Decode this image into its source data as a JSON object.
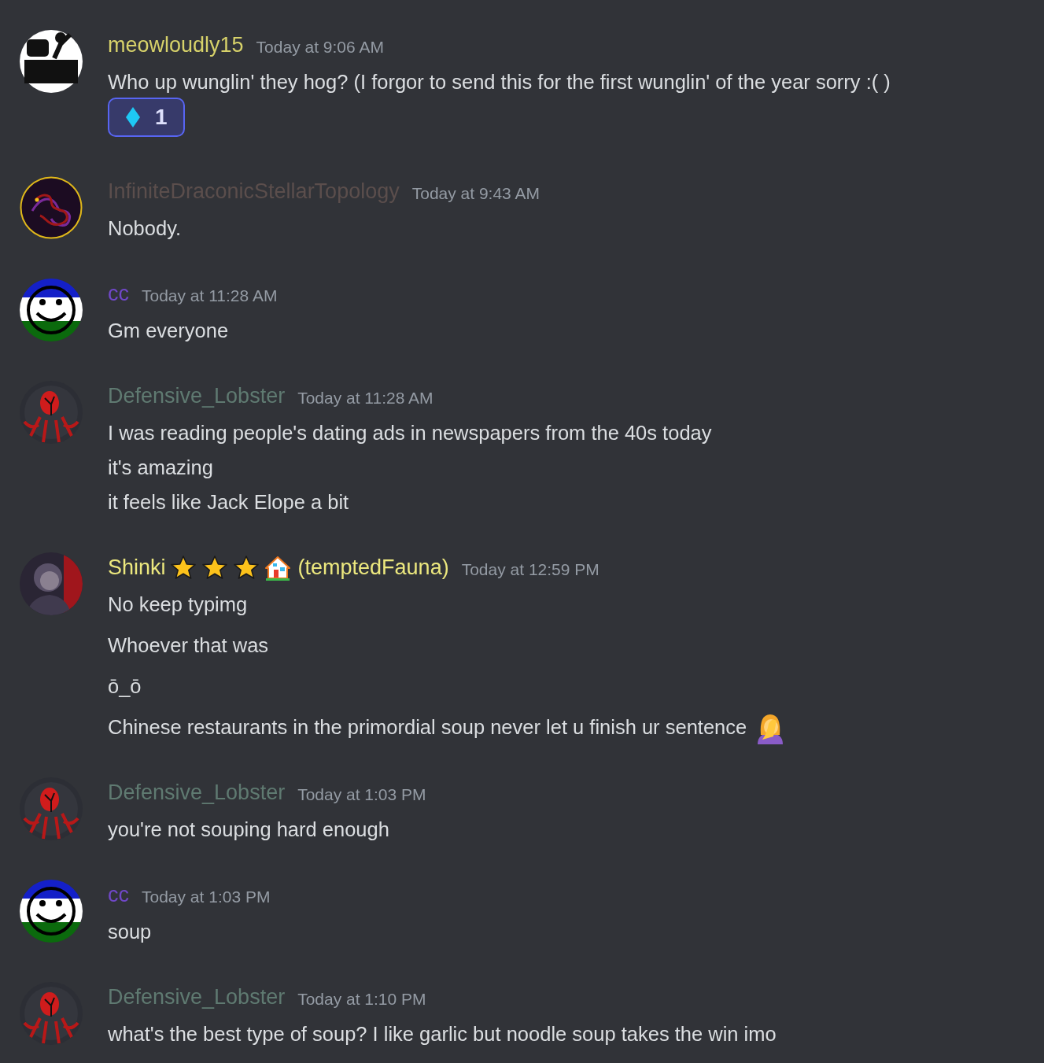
{
  "groups": [
    {
      "avatar": {
        "kind": "sign"
      },
      "author": "meowloudly15",
      "color": "#d7d26a",
      "timestamp": "Today at 9:06 AM",
      "messages": [
        {
          "lines": [
            "Who up wunglin' they hog? (I forgor to send this for the first wunglin' of the year sorry :( )"
          ],
          "reactions": [
            {
              "kind": "diamond",
              "count": "1",
              "selected": true
            }
          ]
        }
      ]
    },
    {
      "avatar": {
        "kind": "dragon"
      },
      "author": "InfiniteDraconicStellarTopology",
      "color": "#5b4e4c",
      "timestamp": "Today at 9:43 AM",
      "messages": [
        {
          "lines": [
            "Nobody."
          ]
        }
      ]
    },
    {
      "avatar": {
        "kind": "smiley"
      },
      "author": "cc",
      "color": "#7048c8",
      "timestamp": "Today at 11:28 AM",
      "messages": [
        {
          "lines": [
            "Gm everyone"
          ]
        }
      ]
    },
    {
      "avatar": {
        "kind": "lobster"
      },
      "author": "Defensive_Lobster",
      "color": "#5f7a71",
      "timestamp": "Today at 11:28 AM",
      "messages": [
        {
          "lines": [
            "I was reading people's dating ads in newspapers from the 40s today",
            "it's amazing",
            "it feels like Jack Elope a bit"
          ]
        }
      ]
    },
    {
      "avatar": {
        "kind": "portrait"
      },
      "author": "Shinki",
      "author_badges": [
        {
          "kind": "star"
        },
        {
          "kind": "star"
        },
        {
          "kind": "star"
        },
        {
          "kind": "house"
        }
      ],
      "author_suffix": "(temptedFauna)",
      "color": "#ece87e",
      "timestamp": "Today at 12:59 PM",
      "messages": [
        {
          "lines": [
            "No keep typimg"
          ]
        },
        {
          "lines": [
            "Whoever that was"
          ]
        },
        {
          "lines": [
            "ō_ō"
          ]
        },
        {
          "lines": [
            "Chinese restaurants in the primordial soup never let u finish ur sentence"
          ],
          "trailing_emoji": {
            "kind": "facepalm"
          }
        }
      ]
    },
    {
      "avatar": {
        "kind": "lobster"
      },
      "author": "Defensive_Lobster",
      "color": "#5f7a71",
      "timestamp": "Today at 1:03 PM",
      "messages": [
        {
          "lines": [
            "you're not souping hard enough"
          ]
        }
      ]
    },
    {
      "avatar": {
        "kind": "smiley"
      },
      "author": "cc",
      "color": "#7048c8",
      "timestamp": "Today at 1:03 PM",
      "messages": [
        {
          "lines": [
            "soup"
          ]
        }
      ]
    },
    {
      "avatar": {
        "kind": "lobster"
      },
      "author": "Defensive_Lobster",
      "color": "#5f7a71",
      "timestamp": "Today at 1:10 PM",
      "messages": [
        {
          "lines": [
            "what's the best type of soup? I like garlic but noodle soup takes the win imo"
          ]
        }
      ]
    }
  ]
}
